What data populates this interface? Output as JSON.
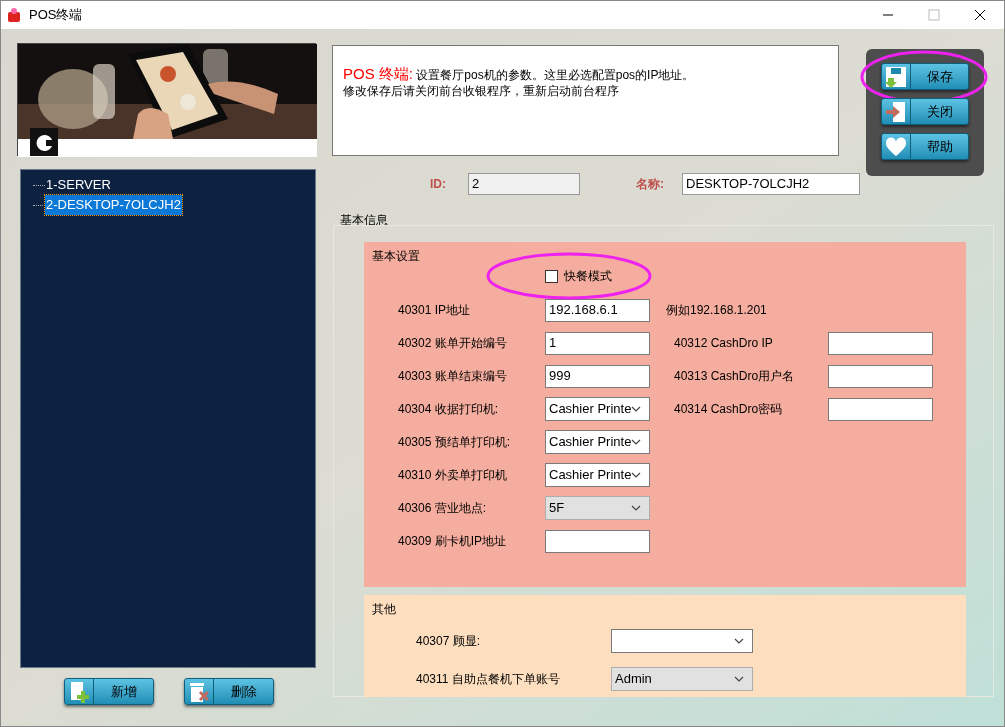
{
  "window": {
    "title": "POS终端"
  },
  "tree": {
    "items": [
      {
        "label": "1-SERVER",
        "selected": false
      },
      {
        "label": "2-DESKTOP-7OLCJH2",
        "selected": true
      }
    ]
  },
  "left_buttons": [
    {
      "label": "新增",
      "kind": "add"
    },
    {
      "label": "删除",
      "kind": "delete"
    }
  ],
  "info": {
    "heading": "POS 终端:",
    "line1": "设置餐厅pos机的参数。这里必选配置pos的IP地址。",
    "line2": "修改保存后请关闭前台收银程序，重新启动前台程序"
  },
  "actions": [
    {
      "label": "保存",
      "kind": "save",
      "highlighted": true
    },
    {
      "label": "关闭",
      "kind": "close",
      "highlighted": false
    },
    {
      "label": "帮助",
      "kind": "help",
      "highlighted": false
    }
  ],
  "id_field": {
    "label": "ID:",
    "value": "2",
    "disabled": true
  },
  "name_field": {
    "label": "名称:",
    "value": "DESKTOP-7OLCJH2",
    "disabled": false
  },
  "group_title": "基本信息",
  "basic": {
    "title": "基本设置",
    "fast_food": {
      "label": "快餐模式",
      "checked": false,
      "highlighted": true
    },
    "rows": [
      {
        "label": "40301 IP地址",
        "kind": "text",
        "value": "192.168.6.1",
        "hint": "例如192.168.1.201"
      },
      {
        "label": "40302 账单开始编号",
        "kind": "text",
        "value": "1"
      },
      {
        "label": "40303 账单结束编号",
        "kind": "text",
        "value": "999"
      },
      {
        "label": "40304 收据打印机:",
        "kind": "select",
        "value": "Cashier Printe",
        "disabled": false
      },
      {
        "label": "40305 预结单打印机:",
        "kind": "select",
        "value": "Cashier Printe",
        "disabled": false
      },
      {
        "label": "40310 外卖单打印机",
        "kind": "select",
        "value": "Cashier Printe",
        "disabled": false
      },
      {
        "label": "40306 营业地点:",
        "kind": "select",
        "value": "5F",
        "disabled": true
      },
      {
        "label": "40309 刷卡机IP地址",
        "kind": "text"
      }
    ],
    "right_rows": [
      {
        "label": "40312 CashDro IP",
        "kind": "text"
      },
      {
        "label": "40313 CashDro用户名",
        "kind": "text"
      },
      {
        "label": "40314 CashDro密码",
        "kind": "text"
      }
    ]
  },
  "other": {
    "title": "其他",
    "rows": [
      {
        "label": "40307 顾显:",
        "kind": "select",
        "disabled": false
      },
      {
        "label": "40311 自助点餐机下单账号",
        "kind": "select",
        "value": "Admin",
        "disabled": true
      }
    ]
  }
}
